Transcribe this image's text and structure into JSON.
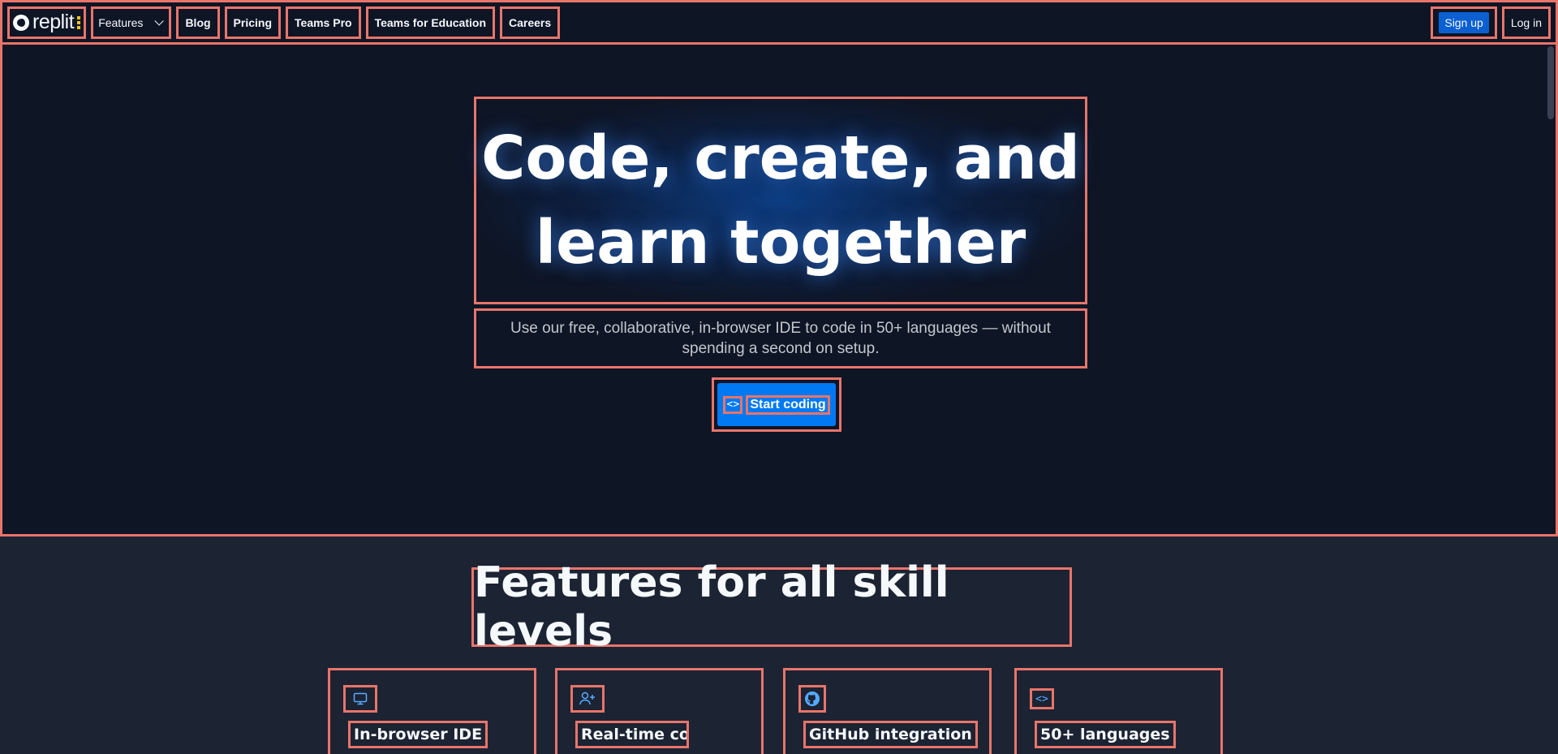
{
  "nav": {
    "logo_text": "replit",
    "items": [
      {
        "label": "Features"
      },
      {
        "label": "Blog"
      },
      {
        "label": "Pricing"
      },
      {
        "label": "Teams Pro"
      },
      {
        "label": "Teams for Education"
      },
      {
        "label": "Careers"
      }
    ],
    "signup_label": "Sign up",
    "login_label": "Log in"
  },
  "hero": {
    "title_line1": "Code, create, and",
    "title_line2": "learn together",
    "subtitle": "Use our free, collaborative, in-browser IDE to code in 50+ languages — without spending a second on setup.",
    "cta_label": "Start coding",
    "cta_icon": "code-icon"
  },
  "features": {
    "title": "Features for all skill levels",
    "cards": [
      {
        "icon": "monitor-icon",
        "label": "In-browser IDE"
      },
      {
        "icon": "user-plus-icon",
        "label": "Real-time collaboration"
      },
      {
        "icon": "github-icon",
        "label": "GitHub integration"
      },
      {
        "icon": "code-icon",
        "label": "50+ languages"
      }
    ]
  },
  "colors": {
    "background": "#0e1525",
    "section_background": "#1c2333",
    "accent": "#0079f2",
    "icon_blue": "#57abff",
    "logo_yellow": "#f5c518"
  }
}
